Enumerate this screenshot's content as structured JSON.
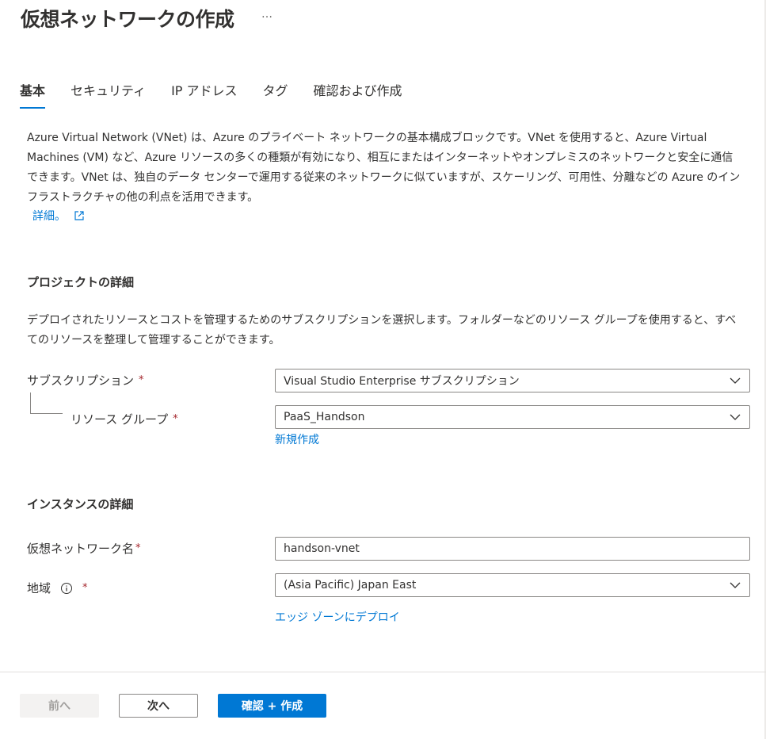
{
  "header": {
    "title": "仮想ネットワークの作成",
    "more_label": "…"
  },
  "tabs": [
    {
      "label": "基本",
      "active": true
    },
    {
      "label": "セキュリティ",
      "active": false
    },
    {
      "label": "IP アドレス",
      "active": false
    },
    {
      "label": "タグ",
      "active": false
    },
    {
      "label": "確認および作成",
      "active": false
    }
  ],
  "intro": {
    "text": "Azure Virtual Network (VNet) は、Azure のプライベート ネットワークの基本構成ブロックです。VNet を使用すると、Azure Virtual Machines (VM) など、Azure リソースの多くの種類が有効になり、相互にまたはインターネットやオンプレミスのネットワークと安全に通信できます。VNet は、独自のデータ センターで運用する従来のネットワークに似ていますが、スケーリング、可用性、分離などの Azure のインフラストラクチャの他の利点を活用できます。",
    "learn_more": "詳細。"
  },
  "project": {
    "title": "プロジェクトの詳細",
    "description": "デプロイされたリソースとコストを管理するためのサブスクリプションを選択します。フォルダーなどのリソース グループを使用すると、すべてのリソースを整理して管理することができます。",
    "subscription_label": "サブスクリプション",
    "subscription_value": "Visual Studio Enterprise サブスクリプション",
    "resource_group_label": "リソース グループ",
    "resource_group_value": "PaaS_Handson",
    "create_new": "新規作成"
  },
  "instance": {
    "title": "インスタンスの詳細",
    "vnet_name_label": "仮想ネットワーク名",
    "vnet_name_value": "handson-vnet",
    "region_label": "地域",
    "region_value": "(Asia Pacific) Japan East",
    "edge_zone_link": "エッジ ゾーンにデプロイ"
  },
  "required_mark": "*",
  "footer": {
    "prev_label": "前へ",
    "next_label": "次へ",
    "review_label": "確認 + 作成"
  },
  "colors": {
    "accent": "#0078d4",
    "required": "#a4262c",
    "text": "#323130"
  }
}
